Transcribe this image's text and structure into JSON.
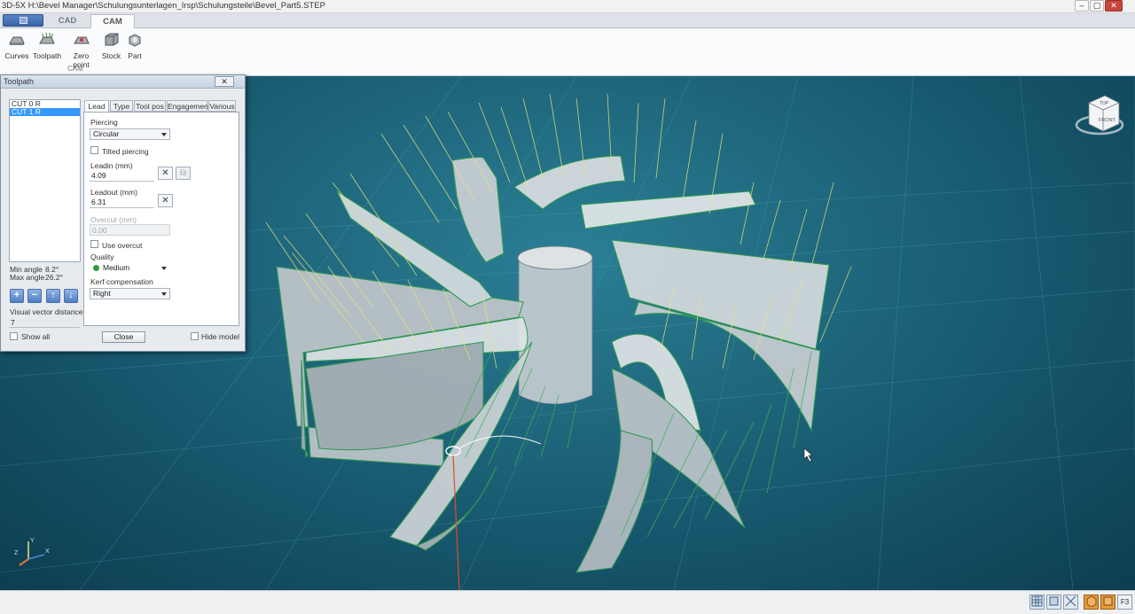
{
  "window": {
    "title": "3D-5X H:\\Bevel Manager\\Schulungsunterlagen_Irsp\\Schulungsteile\\Bevel_Part5.STEP",
    "min": "–",
    "max": "▢",
    "close": "✕"
  },
  "ribbon": {
    "tabs": [
      "CAD",
      "CAM"
    ],
    "buttons": [
      "Curves",
      "Toolpath",
      "Zero point",
      "Stock",
      "Part"
    ],
    "group_label": "CAM"
  },
  "viewcube": {
    "top": "TOP",
    "front": "FRONT"
  },
  "triad": {
    "y": "Y",
    "x": "X",
    "z": "Z"
  },
  "statusbar": {
    "f3": "F3"
  },
  "dialog": {
    "title": "Toolpath",
    "close_glyph": "✕",
    "cuts": [
      "CUT 0 R",
      "CUT 1 R"
    ],
    "selected_cut_index": 1,
    "min_angle_label": "Min angle",
    "min_angle_value": "8.2°",
    "max_angle_label": "Max angle",
    "max_angle_value": "26.2°",
    "vvd_label": "Visual vector distance",
    "vvd_value": "7",
    "show_all_label": "Show all",
    "close_label": "Close",
    "hide_model_label": "Hide model",
    "tabs": [
      "Lead",
      "Type",
      "Tool pos",
      "Engagement",
      "Various"
    ],
    "active_tab": "Lead",
    "piercing_label": "Piercing",
    "piercing_value": "Circular",
    "tilted_piercing_label": "Tilted piercing",
    "leadin_label": "Leadin (mm)",
    "leadin_value": "4.09",
    "leadout_label": "Leadout (mm)",
    "leadout_value": "6.31",
    "overcut_label": "Overcut (mm)",
    "overcut_value": "0.00",
    "use_overcut_label": "Use overcut",
    "quality_label": "Quality",
    "quality_value": "Medium",
    "quality_color": "#2e9a3a",
    "kerf_label": "Kerf compensation",
    "kerf_value": "Right"
  }
}
